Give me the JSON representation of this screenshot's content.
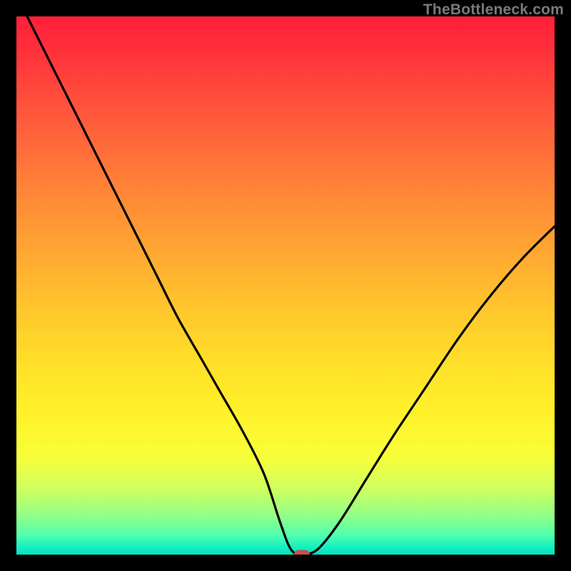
{
  "watermark": "TheBottleneck.com",
  "colors": {
    "frame": "#000000",
    "curve": "#000000",
    "marker": "#c7514b",
    "watermark": "#7a7a7a"
  },
  "chart_data": {
    "type": "line",
    "title": "",
    "xlabel": "",
    "ylabel": "",
    "xlim": [
      0,
      100
    ],
    "ylim": [
      0,
      100
    ],
    "grid": false,
    "annotations": [
      {
        "text": "TheBottleneck.com",
        "position": "top-right"
      }
    ],
    "series": [
      {
        "name": "bottleneck-curve",
        "x": [
          2,
          6,
          10,
          14,
          18,
          22,
          26,
          30,
          34,
          38,
          42,
          46,
          49,
          51,
          53,
          56,
          60,
          65,
          70,
          76,
          82,
          88,
          94,
          100
        ],
        "y": [
          100,
          92,
          84,
          76,
          68,
          60,
          52,
          44,
          37,
          30,
          23,
          15,
          6,
          1,
          0,
          1,
          6,
          14,
          22,
          31,
          40,
          48,
          55,
          61
        ]
      }
    ],
    "marker": {
      "x": 53,
      "y": 0
    },
    "gradient_stops": [
      {
        "pos": 0.0,
        "color": "#ff1f3a"
      },
      {
        "pos": 0.24,
        "color": "#ff6a3b"
      },
      {
        "pos": 0.54,
        "color": "#ffc52d"
      },
      {
        "pos": 0.82,
        "color": "#f7ff3a"
      },
      {
        "pos": 1.0,
        "color": "#00e3c0"
      }
    ]
  }
}
